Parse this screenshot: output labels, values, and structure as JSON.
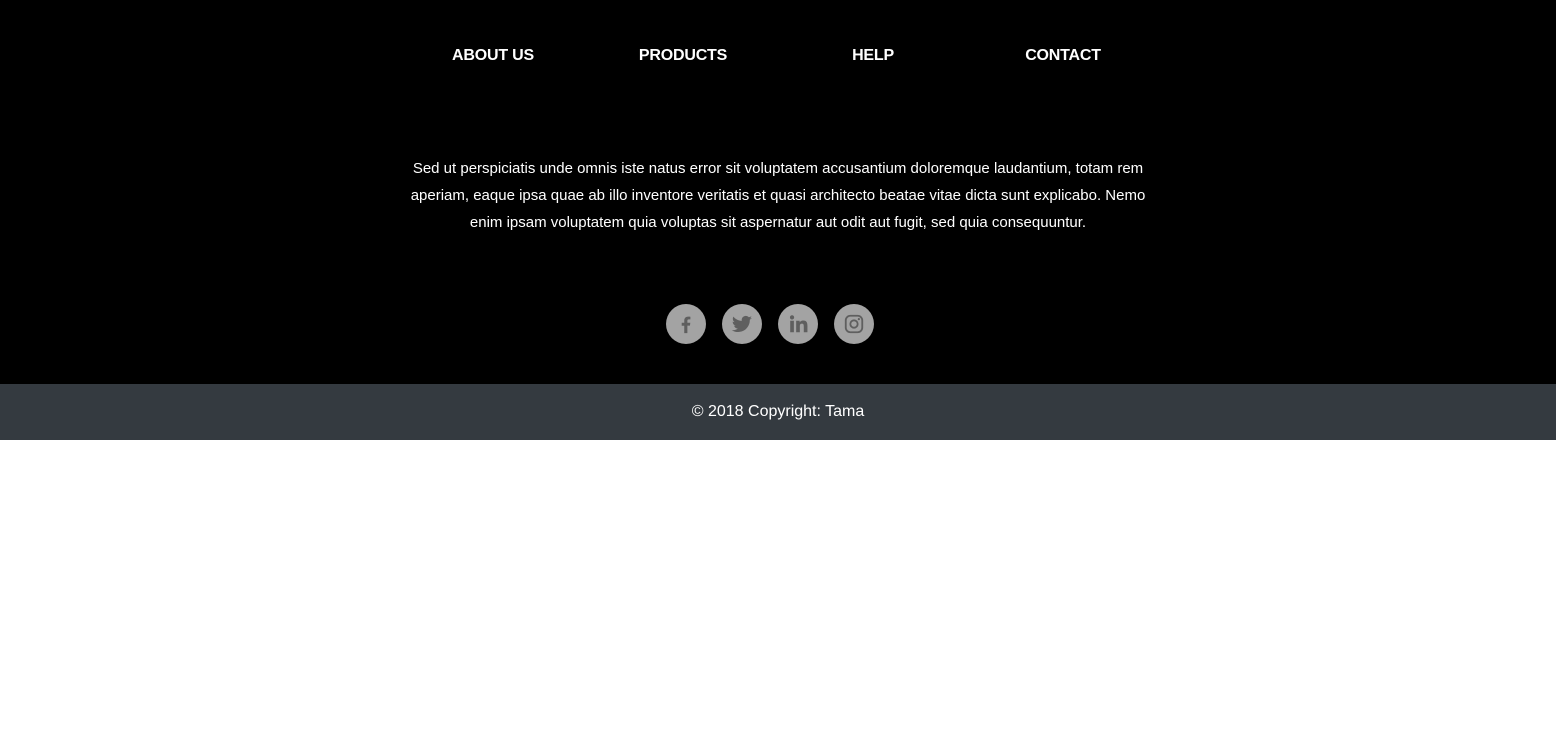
{
  "nav": {
    "items": [
      {
        "label": "ABOUT US"
      },
      {
        "label": "PRODUCTS"
      },
      {
        "label": "HELP"
      },
      {
        "label": "CONTACT"
      }
    ]
  },
  "description": "Sed ut perspiciatis unde omnis iste natus error sit voluptatem accusantium doloremque laudantium, totam rem aperiam, eaque ipsa quae ab illo inventore veritatis et quasi architecto beatae vitae dicta sunt explicabo. Nemo enim ipsam voluptatem quia voluptas sit aspernatur aut odit aut fugit, sed quia consequuntur.",
  "social": [
    {
      "icon": "facebook-icon"
    },
    {
      "icon": "twitter-icon"
    },
    {
      "icon": "linkedin-icon"
    },
    {
      "icon": "instagram-icon"
    }
  ],
  "copyright": "© 2018 Copyright: Tama",
  "colors": {
    "footer_bg": "#000000",
    "copyright_bg": "#343a40",
    "social_bg": "#a3a3a3",
    "social_icon": "#5f5f5f",
    "text": "#ffffff"
  }
}
